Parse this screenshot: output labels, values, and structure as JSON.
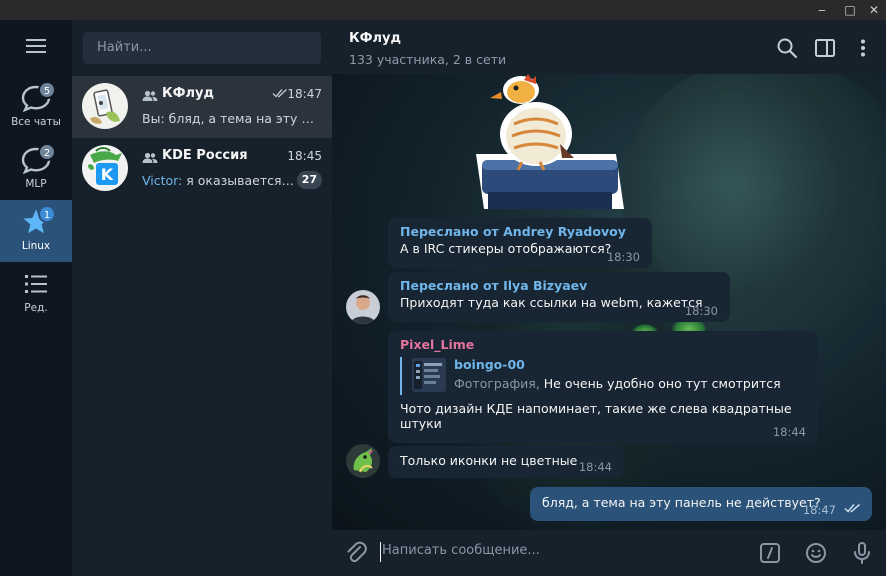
{
  "window": {
    "minimize_glyph": "‒",
    "maximize_glyph": "□",
    "close_glyph": "✕"
  },
  "folders": [
    {
      "label": "Все чаты",
      "badge": "5",
      "icon": "chat-bubble-icon",
      "active": false
    },
    {
      "label": "MLP",
      "badge": "2",
      "icon": "chat-bubble-icon",
      "active": false
    },
    {
      "label": "Linux",
      "badge": "1",
      "icon": "star-icon",
      "active": true
    },
    {
      "label": "Ред.",
      "badge": "",
      "icon": "list-icon",
      "active": false
    }
  ],
  "search": {
    "placeholder": "Найти..."
  },
  "chats": [
    {
      "name": "КФлуд",
      "time": "18:47",
      "read": true,
      "preview_sender": "",
      "preview": "Вы: бляд, а тема на эту панель не действует?",
      "unread": ""
    },
    {
      "name": "KDE Россия",
      "time": "18:45",
      "read": false,
      "preview_sender": "Victor:",
      "preview": " я оказывается у меня всё так",
      "unread": "27"
    }
  ],
  "header": {
    "title": "КФлуд",
    "subtitle": "133 участника, 2 в сети"
  },
  "messages": [
    {
      "forward_label": "Переслано от Andrey Ryadovoy",
      "text": "А в IRC стикеры отображаются?",
      "time": "18:30"
    },
    {
      "forward_label": "Переслано от Ilya Bizyaev",
      "text": "Приходят туда как ссылки на webm, кажется",
      "time": "18:30"
    },
    {
      "author": "Pixel_Lime",
      "author_color": "#e4739f",
      "reply_name": "boingo-00",
      "reply_kind": "Фотография,",
      "reply_text": " Не очень удобно оно тут смотрится",
      "text": "Чото дизайн КДЕ напоминает, такие же слева квадратные штуки",
      "time": "18:44"
    },
    {
      "text": "Только иконки не цветные",
      "time": "18:44"
    },
    {
      "text": "бляд, а тема на эту панель не действует?",
      "time": "18:47",
      "outgoing": true
    }
  ],
  "composer": {
    "placeholder": "Написать сообщение..."
  },
  "colors": {
    "accent": "#2b5278",
    "link": "#70b6ea",
    "incoming_bubble": "#182533",
    "outgoing_bubble": "#2b5278"
  }
}
